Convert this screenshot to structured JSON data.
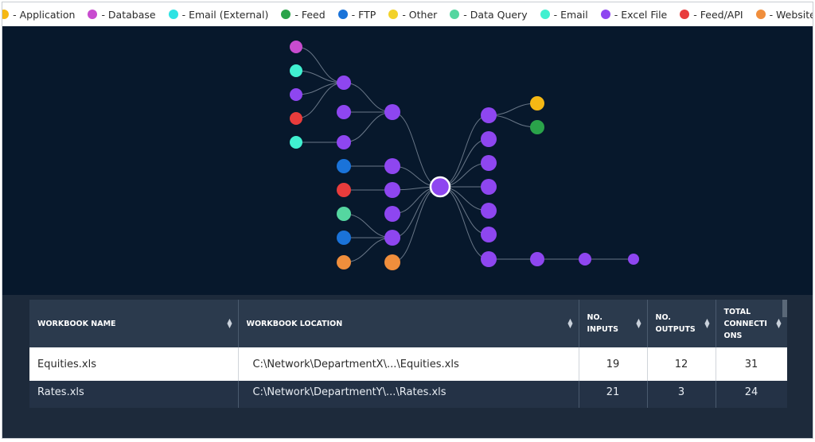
{
  "legend": [
    {
      "label": "- Application",
      "color": "#f5b814"
    },
    {
      "label": "- Database",
      "color": "#c84ccf"
    },
    {
      "label": "- Email (External)",
      "color": "#2ee3e3"
    },
    {
      "label": "- Feed",
      "color": "#2aa34a"
    },
    {
      "label": "- FTP",
      "color": "#1a73d9"
    },
    {
      "label": "- Other",
      "color": "#f2d22a"
    },
    {
      "label": "- Data Query",
      "color": "#55d6a0"
    },
    {
      "label": "- Email",
      "color": "#40f0d0"
    },
    {
      "label": "- Excel File",
      "color": "#8e46f0"
    },
    {
      "label": "- Feed/API",
      "color": "#e83c3c"
    },
    {
      "label": "- Website",
      "color": "#f08e3c"
    }
  ],
  "table": {
    "headers": [
      "WORKBOOK NAME",
      "WORKBOOK LOCATION",
      "NO. INPUTS",
      "NO. OUTPUTS",
      "TOTAL CONNECTIONS"
    ],
    "header_display": [
      "WORKBOOK NAME",
      "WORKBOOK LOCATION",
      "NO. INPUTS",
      "NO.\nOUTPUTS",
      "TOTAL\nCONNECTI\nONS"
    ],
    "rows": [
      {
        "name": "Equities.xls",
        "location": "C:\\Network\\DepartmentX\\...\\Equities.xls",
        "inputs": "19",
        "outputs": "12",
        "total": "31"
      },
      {
        "name": "Rates.xls",
        "location": "C:\\Network\\DepartmentY\\...\\Rates.xls",
        "inputs": "21",
        "outputs": "3",
        "total": "24"
      }
    ]
  }
}
